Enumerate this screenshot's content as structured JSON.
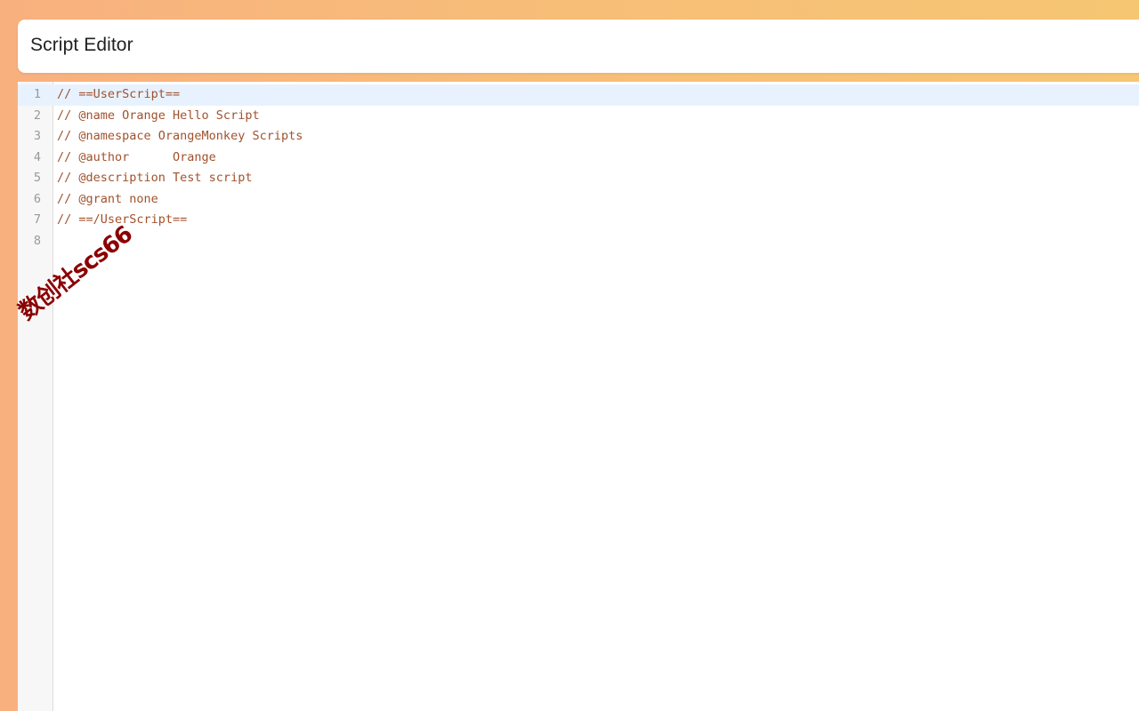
{
  "header": {
    "title": "Script Editor"
  },
  "editor": {
    "lines": [
      {
        "number": "1",
        "code": "// ==UserScript=="
      },
      {
        "number": "2",
        "code": "// @name Orange Hello Script"
      },
      {
        "number": "3",
        "code": "// @namespace OrangeMonkey Scripts"
      },
      {
        "number": "4",
        "code": "// @author      Orange"
      },
      {
        "number": "5",
        "code": "// @description Test script"
      },
      {
        "number": "6",
        "code": "// @grant none"
      },
      {
        "number": "7",
        "code": "// ==/UserScript=="
      },
      {
        "number": "8",
        "code": ""
      }
    ],
    "active_line": 1
  },
  "watermark": {
    "text": "数创社scs66"
  },
  "colors": {
    "background_gradient_start": "#f9b07f",
    "background_gradient_end": "#f6c673",
    "comment_text": "#a0522d",
    "active_line_highlight": "#e8f2ff",
    "watermark": "#8b0000"
  }
}
